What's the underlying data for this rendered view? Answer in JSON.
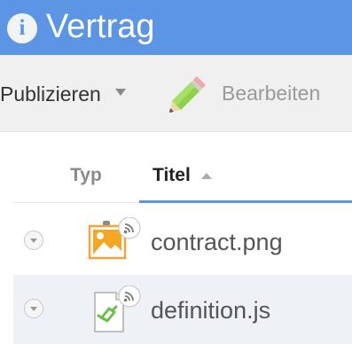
{
  "titlebar": {
    "title": "Vertrag",
    "icon": "info-icon",
    "color": "#5b95e4"
  },
  "toolbar": {
    "publish_label": "Publizieren",
    "publish_icon": "chevron-down-icon",
    "edit_label": "Bearbeiten",
    "edit_icon": "pencil-icon"
  },
  "table": {
    "columns": [
      {
        "label": "Typ",
        "sortable": true
      },
      {
        "label": "Titel",
        "sorted": "ascending"
      }
    ],
    "rows": [
      {
        "name": "contract.png",
        "type_icon": "image-file-icon",
        "badge_icon": "rss-feed-icon"
      },
      {
        "name": "definition.js",
        "type_icon": "script-file-icon",
        "badge_icon": "rss-feed-icon"
      }
    ]
  }
}
